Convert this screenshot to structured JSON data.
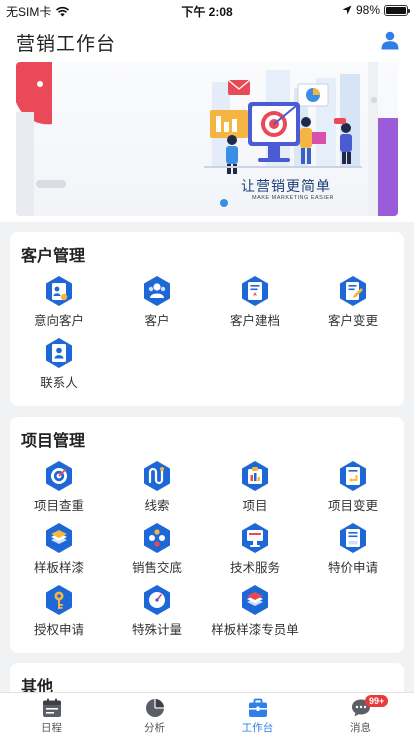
{
  "status_bar": {
    "carrier": "无SIM卡",
    "time": "下午 2:08",
    "battery": "98%",
    "battery_level": 0.98
  },
  "header": {
    "title": "营销工作台",
    "user_icon": "user-icon"
  },
  "banner": {
    "slogan": "让营销更简单",
    "slogan_en": "MAKE MARKETING EASIER"
  },
  "sections": [
    {
      "title": "客户管理",
      "items": [
        {
          "label": "意向客户",
          "icon": "prospect-icon"
        },
        {
          "label": "客户",
          "icon": "customer-icon"
        },
        {
          "label": "客户建档",
          "icon": "customer-file-icon"
        },
        {
          "label": "客户变更",
          "icon": "customer-edit-icon"
        },
        {
          "label": "联系人",
          "icon": "contact-icon"
        }
      ]
    },
    {
      "title": "项目管理",
      "items": [
        {
          "label": "项目查重",
          "icon": "target-icon"
        },
        {
          "label": "线索",
          "icon": "clue-icon"
        },
        {
          "label": "项目",
          "icon": "project-icon"
        },
        {
          "label": "项目变更",
          "icon": "project-change-icon"
        },
        {
          "label": "样板样漆",
          "icon": "sample-paint-icon"
        },
        {
          "label": "销售交底",
          "icon": "sales-brief-icon"
        },
        {
          "label": "技术服务",
          "icon": "tech-service-icon"
        },
        {
          "label": "特价申请",
          "icon": "special-price-icon"
        },
        {
          "label": "授权申请",
          "icon": "authorization-icon"
        },
        {
          "label": "特殊计量",
          "icon": "measure-icon"
        },
        {
          "label": "样板样漆专员单",
          "icon": "sample-specialist-icon"
        }
      ]
    },
    {
      "title": "其他",
      "items": []
    }
  ],
  "tabbar": [
    {
      "label": "日程",
      "icon": "calendar-icon",
      "active": false
    },
    {
      "label": "分析",
      "icon": "pie-chart-icon",
      "active": false
    },
    {
      "label": "工作台",
      "icon": "briefcase-icon",
      "active": true
    },
    {
      "label": "消息",
      "icon": "message-icon",
      "active": false,
      "badge": "99+"
    }
  ],
  "colors": {
    "accent": "#2f7fe8",
    "icon_blue": "#1d67d6",
    "badge": "#e83b3b"
  }
}
